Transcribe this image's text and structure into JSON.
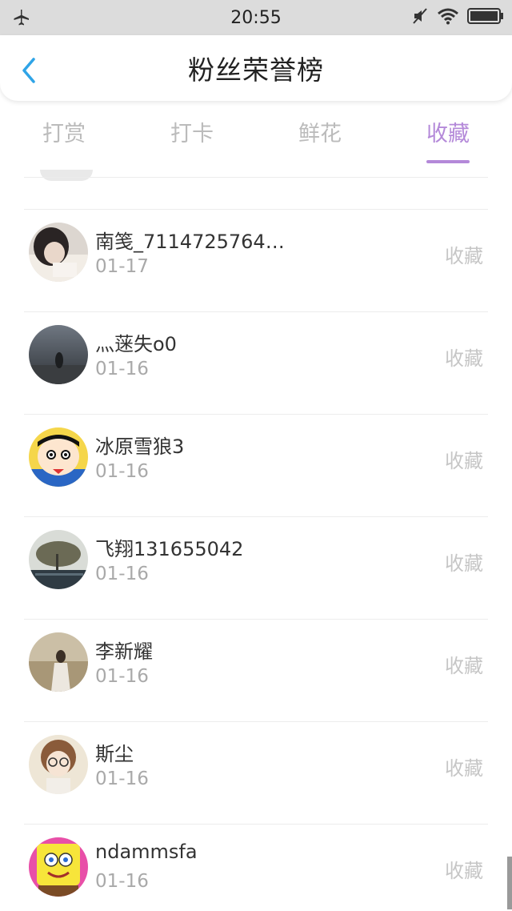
{
  "status_bar": {
    "time": "20:55",
    "icons": [
      "airplane-icon",
      "mute-icon",
      "wifi-icon",
      "battery-icon"
    ]
  },
  "header": {
    "title": "粉丝荣誉榜",
    "back_icon": "chevron-left-icon"
  },
  "tabs": [
    {
      "label": "打赏",
      "active": false
    },
    {
      "label": "打卡",
      "active": false
    },
    {
      "label": "鲜花",
      "active": false
    },
    {
      "label": "收藏",
      "active": true
    }
  ],
  "colors": {
    "accent": "#b489d9",
    "tab_inactive": "#bbbbbb",
    "action_text": "#c6c6c6",
    "date_text": "#a9a9a9"
  },
  "list": {
    "items": [
      {
        "name": "南笺_7114725764…",
        "date": "01-17",
        "action": "收藏",
        "avatar": "girl-photo-avatar"
      },
      {
        "name": "灬蒾失o0",
        "date": "01-16",
        "action": "收藏",
        "avatar": "dark-landscape-avatar"
      },
      {
        "name": "冰原雪狼3",
        "date": "01-16",
        "action": "收藏",
        "avatar": "cartoon-boy-avatar"
      },
      {
        "name": "飞翔131655042",
        "date": "01-16",
        "action": "收藏",
        "avatar": "tree-landscape-avatar"
      },
      {
        "name": "李新耀",
        "date": "01-16",
        "action": "收藏",
        "avatar": "field-photo-avatar"
      },
      {
        "name": "斯尘",
        "date": "01-16",
        "action": "收藏",
        "avatar": "girl-glasses-avatar"
      },
      {
        "name": "ndammsfa",
        "date": "01-16",
        "action": "收藏",
        "avatar": "spongebob-avatar"
      }
    ]
  }
}
